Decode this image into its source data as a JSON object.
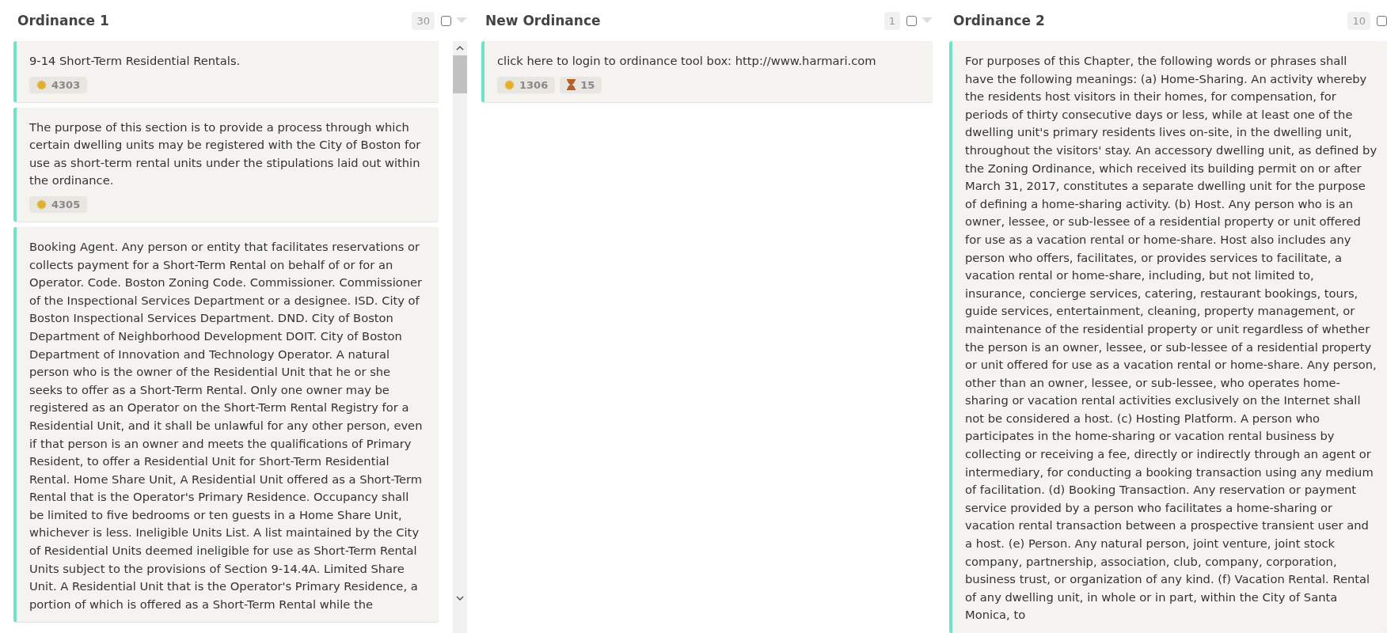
{
  "columns": [
    {
      "title": "Ordinance 1",
      "count": "30",
      "checked": false,
      "caret": true,
      "scrollbar": true,
      "cards": [
        {
          "text": "9-14 Short-Term Residential Rentals.",
          "badges": [
            {
              "kind": "sun",
              "value": "4303"
            }
          ]
        },
        {
          "text": "The purpose of this section is to provide a process through which certain dwelling units may be registered with the City of Boston for use as short-term rental units under the stipulations laid out within the ordinance.",
          "badges": [
            {
              "kind": "sun",
              "value": "4305"
            }
          ]
        },
        {
          "text": "Booking Agent. Any person or entity that facilitates reservations or collects payment for a Short-Term Rental on behalf of or for an Operator. Code. Boston Zoning Code. Commissioner. Commissioner of the Inspectional Services Department or a designee. ISD. City of Boston Inspectional Services Department. DND. City of Boston Department of Neighborhood Development DOIT. City of Boston Department of Innovation and Technology Operator. A natural person who is the owner of the Residential Unit that he or she seeks to offer as a Short-Term Rental. Only one owner may be registered as an Operator on the Short-Term Rental Registry for a Residential Unit, and it shall be unlawful for any other person, even if that person is an owner and meets the qualifications of Primary Resident, to offer a Residential Unit for Short-Term Residential Rental. Home Share Unit, A Residential Unit offered as a Short-Term Rental that is the Operator's Primary Residence. Occupancy shall be limited to five bedrooms or ten guests in a Home Share Unit, whichever is less. Ineligible Units List. A list maintained by the City of Residential Units deemed ineligible for use as Short-Term Rental Units subject to the provisions of Section 9-14.4A. Limited Share Unit. A Residential Unit that is the Operator's Primary Residence, a portion of which is offered as a Short-Term Rental while the"
        }
      ]
    },
    {
      "title": "New Ordinance",
      "count": "1",
      "checked": false,
      "caret": true,
      "cards": [
        {
          "text": "click here to login to ordinance tool box: http://www.harmari.com",
          "badges": [
            {
              "kind": "sun",
              "value": "1306"
            },
            {
              "kind": "hourglass",
              "value": "15"
            }
          ]
        }
      ]
    },
    {
      "title": "Ordinance 2",
      "count": "10",
      "checked": false,
      "cards": [
        {
          "text": "For purposes of this Chapter, the following words or phrases shall have the following meanings: (a) Home-Sharing. An activity whereby the residents host visitors in their homes, for compensation, for periods of thirty consecutive days or less, while at least one of the dwelling unit's primary residents lives on-site, in the dwelling unit, throughout the visitors' stay. An accessory dwelling unit, as defined by the Zoning Ordinance, which received its building permit on or after March 31, 2017, constitutes a separate dwelling unit for the purpose of defining a home-sharing activity. (b) Host. Any person who is an owner, lessee, or sub-lessee of a residential property or unit offered for use as a vacation rental or home-share. Host also includes any person who offers, facilitates, or provides services to facilitate, a vacation rental or home-share, including, but not limited to, insurance, concierge services, catering, restaurant bookings, tours, guide services, entertainment, cleaning, property management, or maintenance of the residential property or unit regardless of whether the person is an owner, lessee, or sub-lessee of a residential property or unit offered for use as a vacation rental or home-share. Any person, other than an owner, lessee, or sub-lessee, who operates home-sharing or vacation rental activities exclusively on the Internet shall not be considered a host. (c) Hosting Platform. A person who participates in the home-sharing or vacation rental business by collecting or receiving a fee, directly or indirectly through an agent or intermediary, for conducting a booking transaction using any medium of facilitation. (d) Booking Transaction. Any reservation or payment service provided by a person who facilitates a home-sharing or vacation rental transaction between a prospective transient user and a host. (e) Person. Any natural person, joint venture, joint stock company, partnership, association, club, company, corporation, business trust, or organization of any kind. (f) Vacation Rental. Rental of any dwelling unit, in whole or in part, within the City of Santa Monica, to"
        }
      ]
    }
  ]
}
